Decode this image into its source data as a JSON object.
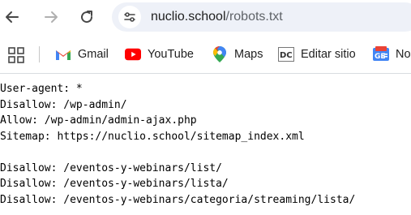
{
  "browser": {
    "address_bar": {
      "domain": "nuclio.school",
      "path": "/robots.txt"
    },
    "bookmarks": [
      {
        "label": "Gmail",
        "icon": "gmail-icon"
      },
      {
        "label": "YouTube",
        "icon": "youtube-icon"
      },
      {
        "label": "Maps",
        "icon": "maps-icon"
      },
      {
        "label": "Editar sitio",
        "icon": "editar-sitio-icon"
      },
      {
        "label": "No",
        "icon": "google-news-icon"
      }
    ],
    "colors": {
      "youtube_red": "#ff0000",
      "gmail_red": "#ea4335",
      "maps_green": "#34a853",
      "news_blue": "#4285f4"
    }
  },
  "document": {
    "lines": [
      "User-agent: *",
      "Disallow: /wp-admin/",
      "Allow: /wp-admin/admin-ajax.php",
      "Sitemap: https://nuclio.school/sitemap_index.xml",
      "",
      "Disallow: /eventos-y-webinars/list/",
      "Disallow: /eventos-y-webinars/lista/",
      "Disallow: /eventos-y-webinars/categoria/streaming/lista/"
    ]
  }
}
